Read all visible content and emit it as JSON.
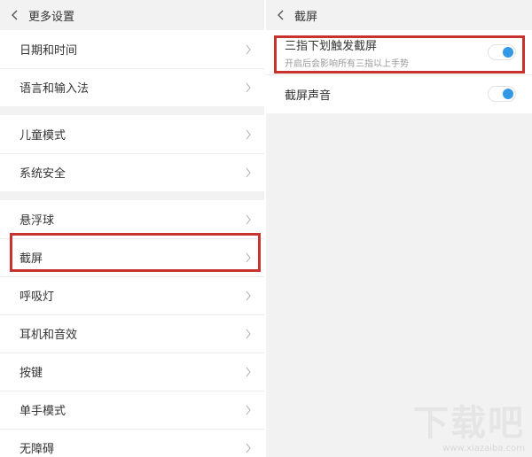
{
  "left": {
    "title": "更多设置",
    "groups": [
      [
        "日期和时间",
        "语言和输入法"
      ],
      [
        "儿童模式",
        "系统安全"
      ],
      [
        "悬浮球",
        "截屏",
        "呼吸灯",
        "耳机和音效",
        "按键",
        "单手模式",
        "无障碍"
      ]
    ]
  },
  "right": {
    "title": "截屏",
    "items": [
      {
        "title": "三指下划触发截屏",
        "subtitle": "开启后会影响所有三指以上手势",
        "toggle_on": true
      },
      {
        "title": "截屏声音",
        "toggle_on": true
      }
    ]
  },
  "colors": {
    "accent": "#3399e6",
    "highlight": "#c9332f"
  },
  "icons": {
    "back": "chevron-left-icon",
    "row": "chevron-right-icon"
  },
  "watermark": {
    "logo": "下载吧",
    "url": "www.xiazaiba.com"
  }
}
